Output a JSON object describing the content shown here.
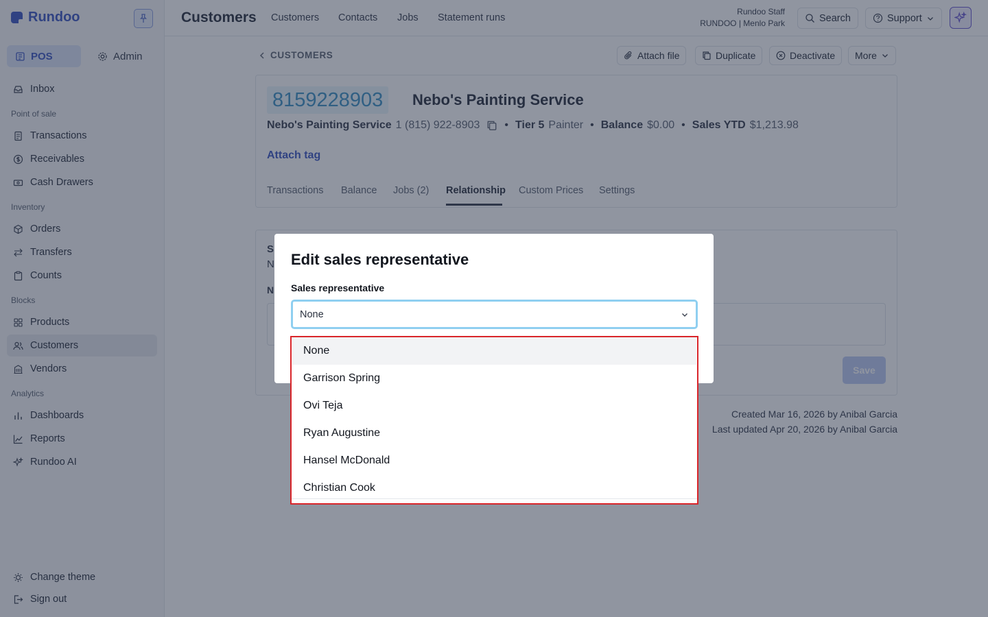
{
  "app": {
    "brand": "Rundoo",
    "colors": {
      "accent": "#3f59c2",
      "id_badge_text": "#3e92c4",
      "focus_ring": "#8fcff0",
      "highlight_border": "#d9252a"
    }
  },
  "sidebar": {
    "modes": [
      {
        "label": "POS",
        "icon": "store-icon",
        "active": true
      },
      {
        "label": "Admin",
        "icon": "gear-icon",
        "active": false
      }
    ],
    "inbox": "Inbox",
    "sections": {
      "pos": "Point of sale",
      "inventory": "Inventory",
      "blocks": "Blocks",
      "analytics": "Analytics"
    },
    "items": {
      "transactions": "Transactions",
      "receivables": "Receivables",
      "cash_drawers": "Cash Drawers",
      "orders": "Orders",
      "transfers": "Transfers",
      "counts": "Counts",
      "products": "Products",
      "customers": "Customers",
      "vendors": "Vendors",
      "dashboards": "Dashboards",
      "reports": "Reports",
      "rundoo_ai": "Rundoo AI"
    },
    "change_theme": "Change theme",
    "sign_out": "Sign out"
  },
  "topbar": {
    "title": "Customers",
    "tabs": [
      "Customers",
      "Contacts",
      "Jobs",
      "Statement runs"
    ],
    "staff_name": "Rundoo Staff",
    "location": "RUNDOO | Menlo Park",
    "search": "Search",
    "support": "Support"
  },
  "page": {
    "breadcrumb": "CUSTOMERS",
    "actions": {
      "attach_file": "Attach file",
      "duplicate": "Duplicate",
      "deactivate": "Deactivate",
      "more": "More"
    },
    "customer": {
      "id": "8159228903",
      "name": "Nebo's Painting Service",
      "contact_name": "Nebo's Painting Service",
      "phone": "1 (815) 922-8903",
      "tier_label": "Tier 5",
      "tier_value": "Painter",
      "balance_label": "Balance",
      "balance_value": "$0.00",
      "sales_ytd_label": "Sales YTD",
      "sales_ytd_value": "$1,213.98"
    },
    "attach_tag": "Attach tag",
    "tabs": [
      "Transactions",
      "Balance",
      "Jobs (2)",
      "Relationship",
      "Custom Prices",
      "Settings"
    ],
    "active_tab": "Relationship",
    "bg_fragments": {
      "s": "S",
      "n1": "N",
      "n2": "N"
    },
    "save": "Save",
    "created": "Created Mar 16, 2026 by Anibal Garcia",
    "updated": "Last updated Apr 20, 2026 by Anibal Garcia"
  },
  "modal": {
    "title": "Edit sales representative",
    "field_label": "Sales representative",
    "selected_value": "None",
    "options": [
      "None",
      "Garrison Spring",
      "Ovi Teja",
      "Ryan Augustine",
      "Hansel McDonald",
      "Christian Cook"
    ],
    "highlighted_option": "None"
  }
}
